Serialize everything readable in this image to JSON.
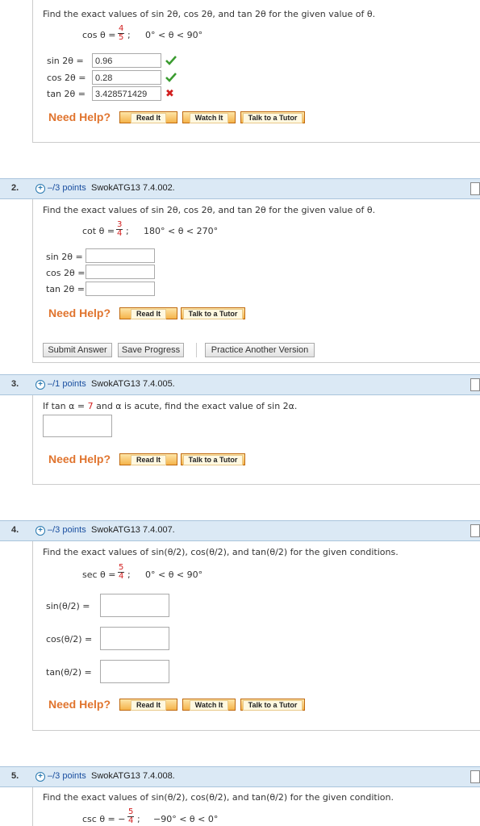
{
  "q1": {
    "prompt": "Find the exact values of sin 2θ, cos 2θ, and tan 2θ for the given value of θ.",
    "given_func": "cos θ =",
    "frac_num": "4",
    "frac_den": "5",
    "semicolon": ";",
    "range": "0° < θ < 90°",
    "rows": [
      {
        "label": "sin 2θ  =",
        "value": "0.96",
        "status": "correct"
      },
      {
        "label": "cos 2θ  =",
        "value": "0.28",
        "status": "correct"
      },
      {
        "label": "tan 2θ  =",
        "value": "3.428571429",
        "status": "incorrect"
      }
    ],
    "need_help": "Need Help?",
    "buttons": [
      "Read It",
      "Watch It",
      "Talk to a Tutor"
    ]
  },
  "q2": {
    "number": "2.",
    "points": "–/3 points",
    "code": "SwokATG13 7.4.002.",
    "prompt": "Find the exact values of sin 2θ, cos 2θ, and tan 2θ for the given value of θ.",
    "given_func": "cot θ =",
    "frac_num": "3",
    "frac_den": "4",
    "semicolon": ";",
    "range": "180° < θ < 270°",
    "rows": [
      {
        "label": "sin 2θ =",
        "value": ""
      },
      {
        "label": "cos 2θ =",
        "value": ""
      },
      {
        "label": "tan 2θ =",
        "value": ""
      }
    ],
    "need_help": "Need Help?",
    "buttons": [
      "Read It",
      "Talk to a Tutor"
    ],
    "submit": "Submit Answer",
    "save": "Save Progress",
    "practice": "Practice Another Version"
  },
  "q3": {
    "number": "3.",
    "points": "–/1 points",
    "code": "SwokATG13 7.4.005.",
    "prompt_a": "If tan α =",
    "prompt_val": "7",
    "prompt_b": "and α is acute, find the exact value of sin 2α.",
    "need_help": "Need Help?",
    "buttons": [
      "Read It",
      "Talk to a Tutor"
    ]
  },
  "q4": {
    "number": "4.",
    "points": "–/3 points",
    "code": "SwokATG13 7.4.007.",
    "prompt": "Find the exact values of sin(θ/2), cos(θ/2), and tan(θ/2) for the given conditions.",
    "given_func": "sec θ =",
    "frac_num": "5",
    "frac_den": "4",
    "semicolon": ";",
    "range": "0° < θ < 90°",
    "rows": [
      {
        "label": "sin(θ/2)  =",
        "value": ""
      },
      {
        "label": "cos(θ/2)  =",
        "value": ""
      },
      {
        "label": "tan(θ/2)  =",
        "value": ""
      }
    ],
    "need_help": "Need Help?",
    "buttons": [
      "Read It",
      "Watch It",
      "Talk to a Tutor"
    ]
  },
  "q5": {
    "number": "5.",
    "points": "–/3 points",
    "code": "SwokATG13 7.4.008.",
    "prompt": "Find the exact values of sin(θ/2), cos(θ/2), and tan(θ/2) for the given condition.",
    "given_func": "csc θ = −",
    "frac_num": "5",
    "frac_den": "4",
    "semicolon": ";",
    "range": "−90° < θ < 0°"
  }
}
